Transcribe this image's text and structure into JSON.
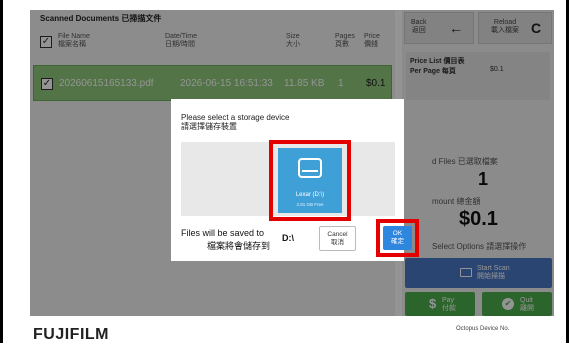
{
  "list": {
    "title": "Scanned Documents 已掃描文件",
    "headers": {
      "filename": [
        "File Name",
        "檔案名稱"
      ],
      "datetime": [
        "Date/Time",
        "日期/時間"
      ],
      "size": [
        "Size",
        "大小"
      ],
      "pages": [
        "Pages",
        "頁數"
      ],
      "price": [
        "Price",
        "價錢"
      ]
    },
    "rows": [
      {
        "filename": "20260615165133.pdf",
        "datetime": "2026-06-15 16:51:33",
        "size": "11.85 KB",
        "pages": "1",
        "price": "$0.1",
        "selected": true
      }
    ],
    "check_glyph": "✓"
  },
  "sidebar": {
    "back": {
      "label_en": "Back",
      "label_zh": "返回",
      "icon": "arrow-left-icon",
      "glyph": "←"
    },
    "reload": {
      "label_en": "Reload",
      "label_zh": "載入檔案",
      "icon": "reload-icon",
      "glyph": "C"
    },
    "price_list": {
      "title": "Price List 價目表",
      "per_page_label": "Per Page 每頁",
      "per_page_value": "$0.1"
    },
    "selected_files_label": "d Files 已選取檔案",
    "selected_files_value": "1",
    "amount_label": "mount 總金額",
    "amount_value": "$0.1",
    "options_label": "Select Options 請選擇操作",
    "scan": {
      "label_en": "Start Scan",
      "label_zh": "開始掃描",
      "icon": "print-icon"
    },
    "pay": {
      "label_en": "Pay",
      "label_zh": "付款",
      "icon": "dollar-icon",
      "glyph": "$"
    },
    "quit": {
      "label_en": "Quit",
      "label_zh": "離開",
      "icon": "check-circle-icon",
      "glyph": "✔"
    }
  },
  "footer": {
    "logo": "FUJIFILM",
    "device_label": "Octopus Device No."
  },
  "dialog": {
    "title_en": "Please select a storage device",
    "title_zh": "請選擇儲存裝置",
    "device": {
      "name": "Lexar (D:\\)",
      "free": "2.81 GB Free",
      "icon": "hard-drive-icon"
    },
    "save_text_en": "Files will be saved to",
    "save_text_zh": "檔案將會儲存到",
    "save_path": "D:\\",
    "cancel_en": "Cancel",
    "cancel_zh": "取消",
    "ok_en": "OK",
    "ok_zh": "確定"
  },
  "colors": {
    "selected_row": "#8dc87a",
    "device_tile": "#3fa0d8",
    "highlight": "#e50000",
    "ok_button": "#2e86de",
    "scan_button": "#4a78c4",
    "green_button": "#4cae4c"
  }
}
